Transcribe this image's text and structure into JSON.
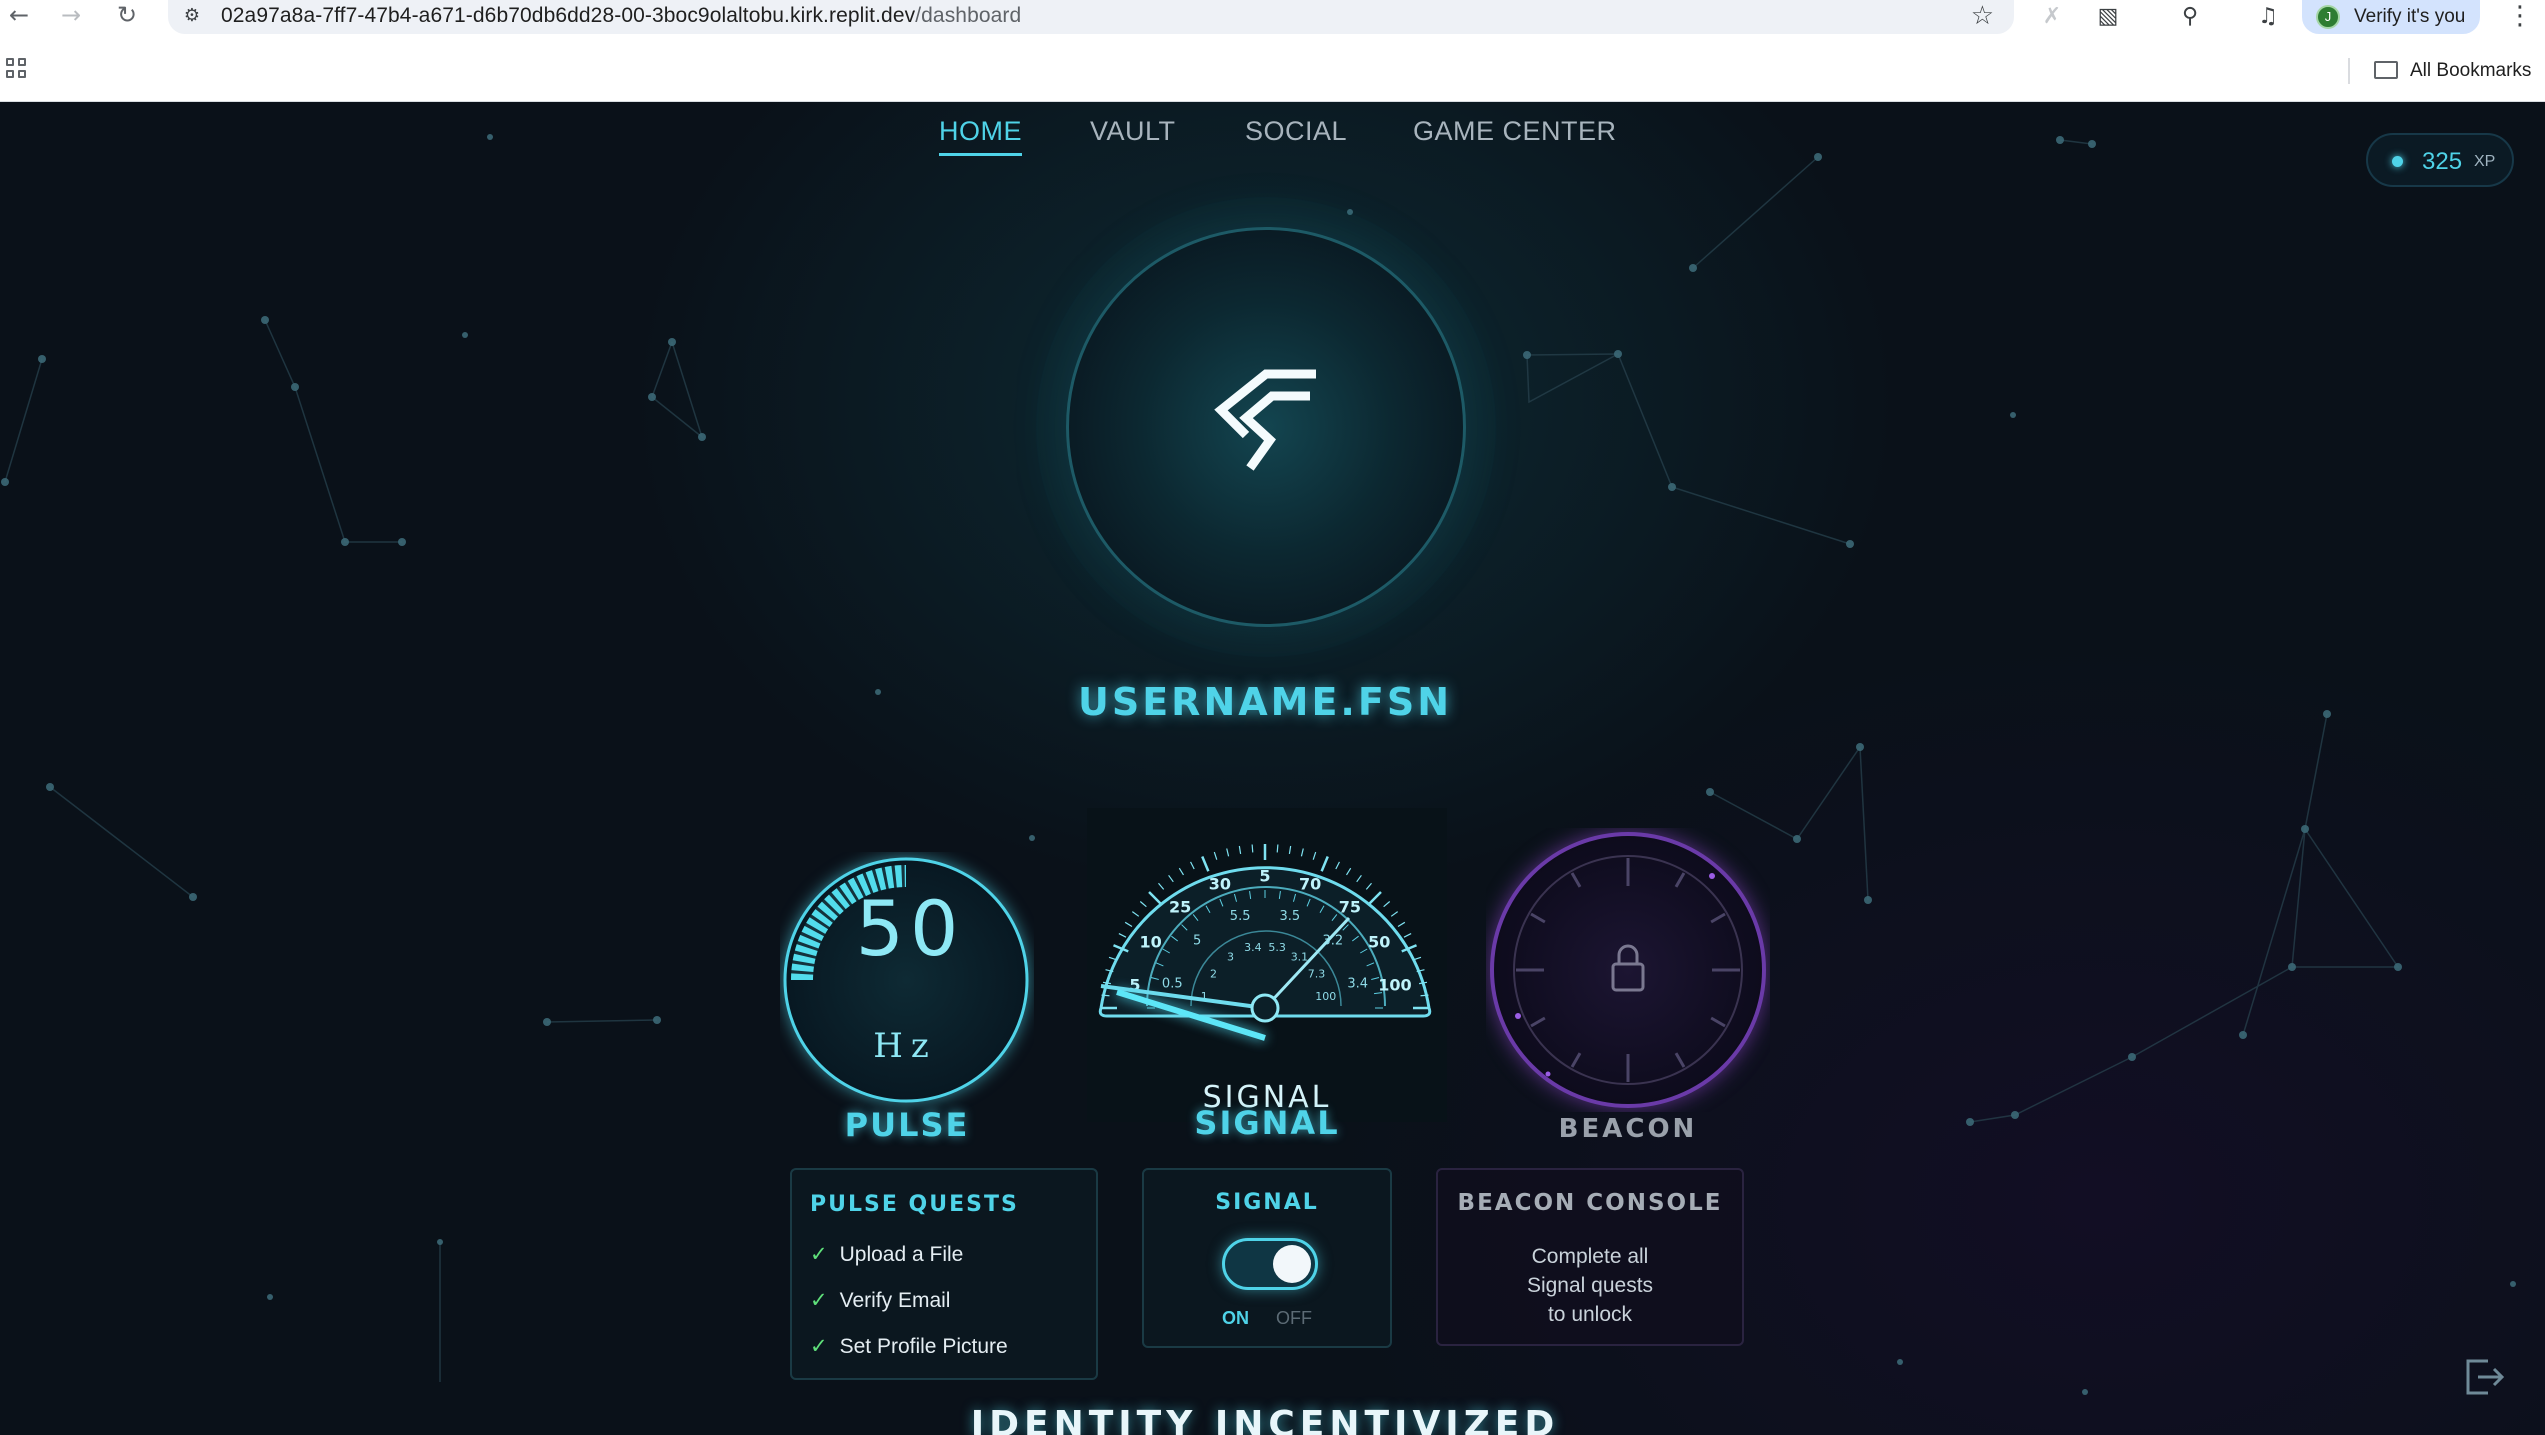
{
  "browser": {
    "url_host": "02a97a8a-7ff7-47b4-a671-d6b70db6dd28-00-3boc9olaltobu.kirk.replit.dev",
    "url_path": "/dashboard",
    "profile_initial": "J",
    "profile_label": "Verify it's you",
    "bookmarks_label": "All Bookmarks",
    "icons": [
      "back-icon",
      "forward-icon",
      "reload-icon",
      "site-info-icon",
      "star-icon",
      "extensions-icon",
      "search-page-icon",
      "media-control-icon",
      "menu-icon",
      "apps-icon",
      "folder-icon"
    ]
  },
  "nav": {
    "items": [
      "HOME",
      "VAULT",
      "SOCIAL",
      "GAME CENTER"
    ],
    "active": "HOME"
  },
  "xp": {
    "value": "325",
    "unit": "XP"
  },
  "profile": {
    "username": "USERNAME.FSN"
  },
  "gauges": {
    "pulse": {
      "value": "50",
      "unit": "Hz",
      "label": "PULSE",
      "fill_fraction": 0.25
    },
    "signal": {
      "label_overlay": "SIGNAL",
      "label": "SIGNAL",
      "outer_ticks": [
        "5",
        "10",
        "25",
        "30",
        "5",
        "70",
        "75",
        "50",
        "100"
      ],
      "middle_ticks": [
        "0.5",
        "5",
        "5.5",
        "3.5",
        "3.2",
        "3.4"
      ],
      "inner_ticks": [
        "1",
        "2",
        "3",
        "3.4",
        "5.3",
        "3.1",
        "7.3",
        "100"
      ]
    },
    "beacon": {
      "label": "BEACON",
      "locked": true
    }
  },
  "cards": {
    "pulse_quests": {
      "title": "PULSE QUESTS",
      "items": [
        "Upload a File",
        "Verify Email",
        "Set Profile Picture"
      ]
    },
    "signal": {
      "title": "SIGNAL",
      "on_label": "ON",
      "off_label": "OFF",
      "state": "ON"
    },
    "beacon_console": {
      "title": "BEACON CONSOLE",
      "message_lines": [
        "Complete all",
        "Signal quests",
        "to unlock"
      ]
    }
  },
  "footer": {
    "title": "IDENTITY INCENTIVIZED"
  },
  "colors": {
    "accent": "#4fd3e8",
    "beacon_purple": "#7a3fb0",
    "check_green": "#5fe07a",
    "background": "#0a1119"
  }
}
